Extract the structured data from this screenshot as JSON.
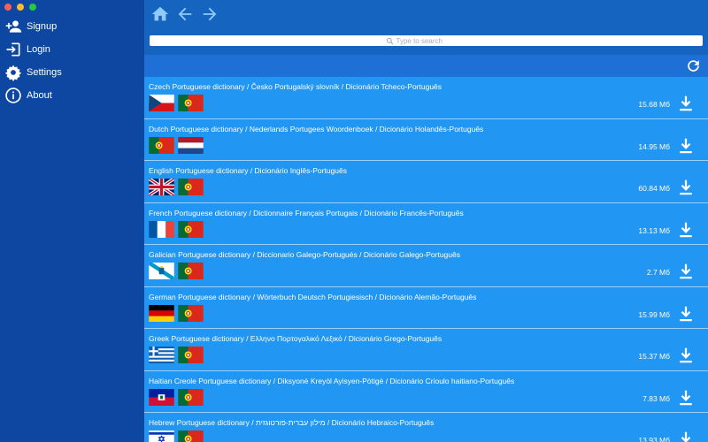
{
  "colors": {
    "sidebar": "#0d47a1",
    "topbar": "#1565c0",
    "list": "#2196f3"
  },
  "sidebar": {
    "items": [
      {
        "label": "Signup",
        "icon": "add-user-icon"
      },
      {
        "label": "Login",
        "icon": "login-icon"
      },
      {
        "label": "Settings",
        "icon": "gear-icon"
      },
      {
        "label": "About",
        "icon": "info-icon"
      }
    ]
  },
  "search": {
    "placeholder": "Type to search"
  },
  "dictionaries": [
    {
      "title": "Czech Portuguese dictionary / Česko Portugalský slovník / Dicionário Tcheco-Português",
      "size": "15.68 Мб",
      "flags": [
        "czech-flag-icon",
        "portugal-flag-icon"
      ]
    },
    {
      "title": "Dutch Portuguese dictionary / Nederlands Portugees Woordenboek / Dicionário Holandês-Português",
      "size": "14.95 Мб",
      "flags": [
        "portugal-flag-icon",
        "netherlands-flag-icon"
      ]
    },
    {
      "title": "English Portuguese dictionary / Dicionário Inglês-Português",
      "size": "60.84 Мб",
      "flags": [
        "uk-flag-icon",
        "portugal-flag-icon"
      ]
    },
    {
      "title": "French Portuguese dictionary / Dictionnaire Français Portugais / Dicionário Francês-Português",
      "size": "13.13 Мб",
      "flags": [
        "france-flag-icon",
        "portugal-flag-icon"
      ]
    },
    {
      "title": "Galician Portuguese dictionary / Diccionario Galego-Portugués / Dicionário Galego-Português",
      "size": "2.7 Мб",
      "flags": [
        "galicia-flag-icon",
        "portugal-flag-icon"
      ]
    },
    {
      "title": "German Portuguese dictionary / Wörterbuch Deutsch Portugiesisch / Dicionário Alemão-Português",
      "size": "15.99 Мб",
      "flags": [
        "germany-flag-icon",
        "portugal-flag-icon"
      ]
    },
    {
      "title": "Greek Portuguese dictionary / Ελληνο Πορτογαλικό Λεξικό / Dicionário Grego-Português",
      "size": "15.37 Мб",
      "flags": [
        "greece-flag-icon",
        "portugal-flag-icon"
      ]
    },
    {
      "title": "Haitian Creole Portuguese dictionary / Diksyonè Kreyòl Ayisyen-Pòtigè / Dicionário Crioulo haitiano-Português",
      "size": "7.83 Мб",
      "flags": [
        "haiti-flag-icon",
        "portugal-flag-icon"
      ]
    },
    {
      "title": "Hebrew Portuguese dictionary / מילון עברית-פורטוגזית / Dicionário Hebraico-Português",
      "size": "13.93 Мб",
      "flags": [
        "israel-flag-icon",
        "portugal-flag-icon"
      ]
    }
  ]
}
